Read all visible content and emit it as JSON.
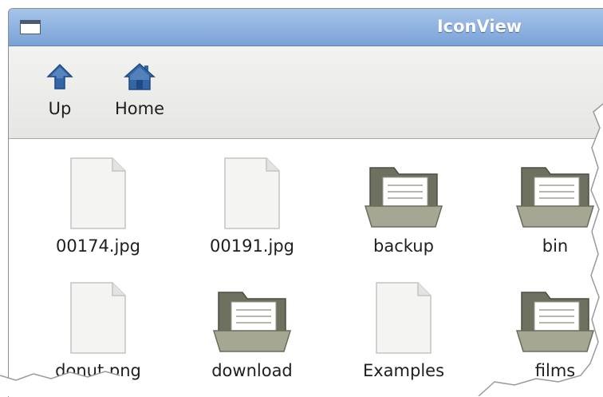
{
  "window": {
    "title": "IconView",
    "icon": "window-icon"
  },
  "toolbar": {
    "buttons": [
      {
        "label": "Up",
        "icon": "up-arrow-icon"
      },
      {
        "label": "Home",
        "icon": "home-icon"
      }
    ]
  },
  "files": [
    {
      "name": "00174.jpg",
      "type": "file"
    },
    {
      "name": "00191.jpg",
      "type": "file"
    },
    {
      "name": "backup",
      "type": "folder"
    },
    {
      "name": "bin",
      "type": "folder"
    },
    {
      "name": "donut.png",
      "type": "file"
    },
    {
      "name": "download",
      "type": "folder"
    },
    {
      "name": "Examples",
      "type": "file"
    },
    {
      "name": "films",
      "type": "folder"
    }
  ],
  "colors": {
    "titlebar": "#7aa2d6",
    "toolbar_icon": "#3465a4",
    "folder": "#888a74"
  }
}
